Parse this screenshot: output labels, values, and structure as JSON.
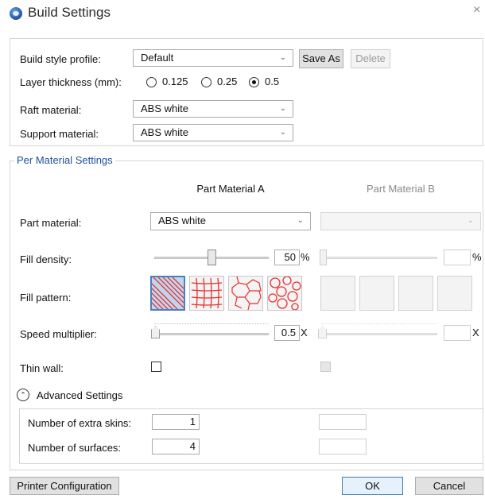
{
  "window": {
    "title": "Build Settings",
    "close_glyph": "×",
    "icon": "app-globe-icon"
  },
  "general": {
    "build_style_profile_label": "Build style profile:",
    "build_style_profile_value": "Default",
    "save_as_label": "Save As",
    "delete_label": "Delete",
    "layer_thickness_label": "Layer thickness (mm):",
    "layer_options": [
      {
        "label": "0.125",
        "checked": false
      },
      {
        "label": "0.25",
        "checked": false
      },
      {
        "label": "0.5",
        "checked": true
      }
    ],
    "raft_material_label": "Raft material:",
    "raft_material_value": "ABS white",
    "support_material_label": "Support material:",
    "support_material_value": "ABS white"
  },
  "per_material": {
    "legend": "Per Material Settings",
    "column_a": "Part Material A",
    "column_b": "Part Material B",
    "part_material_label": "Part material:",
    "part_material_a_value": "ABS white",
    "part_material_b_value": "",
    "fill_density_label": "Fill density:",
    "fill_density_a": 50,
    "fill_density_a_text": "50",
    "fill_density_b_text": "",
    "percent_unit": "%",
    "fill_pattern_label": "Fill pattern:",
    "fill_patterns_a": [
      {
        "name": "diagonal-lines",
        "selected": true
      },
      {
        "name": "grid",
        "selected": false
      },
      {
        "name": "honeycomb",
        "selected": false
      },
      {
        "name": "circles",
        "selected": false
      }
    ],
    "speed_multiplier_label": "Speed multiplier:",
    "speed_multiplier_a_text": "0.5",
    "speed_multiplier_b_text": "",
    "speed_unit": "X",
    "thin_wall_label": "Thin wall:",
    "thin_wall_a_checked": false,
    "thin_wall_b_checked": false
  },
  "advanced": {
    "title": "Advanced Settings",
    "extra_skins_label": "Number of extra skins:",
    "extra_skins_a": "1",
    "extra_skins_b": "",
    "surfaces_label": "Number of surfaces:",
    "surfaces_a": "4",
    "surfaces_b": ""
  },
  "footer": {
    "printer_configuration_label": "Printer Configuration",
    "ok_label": "OK",
    "cancel_label": "Cancel"
  },
  "colors": {
    "accent": "#1f4e9c",
    "pattern_red": "#e8312f",
    "selected_tile": "#bfd6ef"
  }
}
